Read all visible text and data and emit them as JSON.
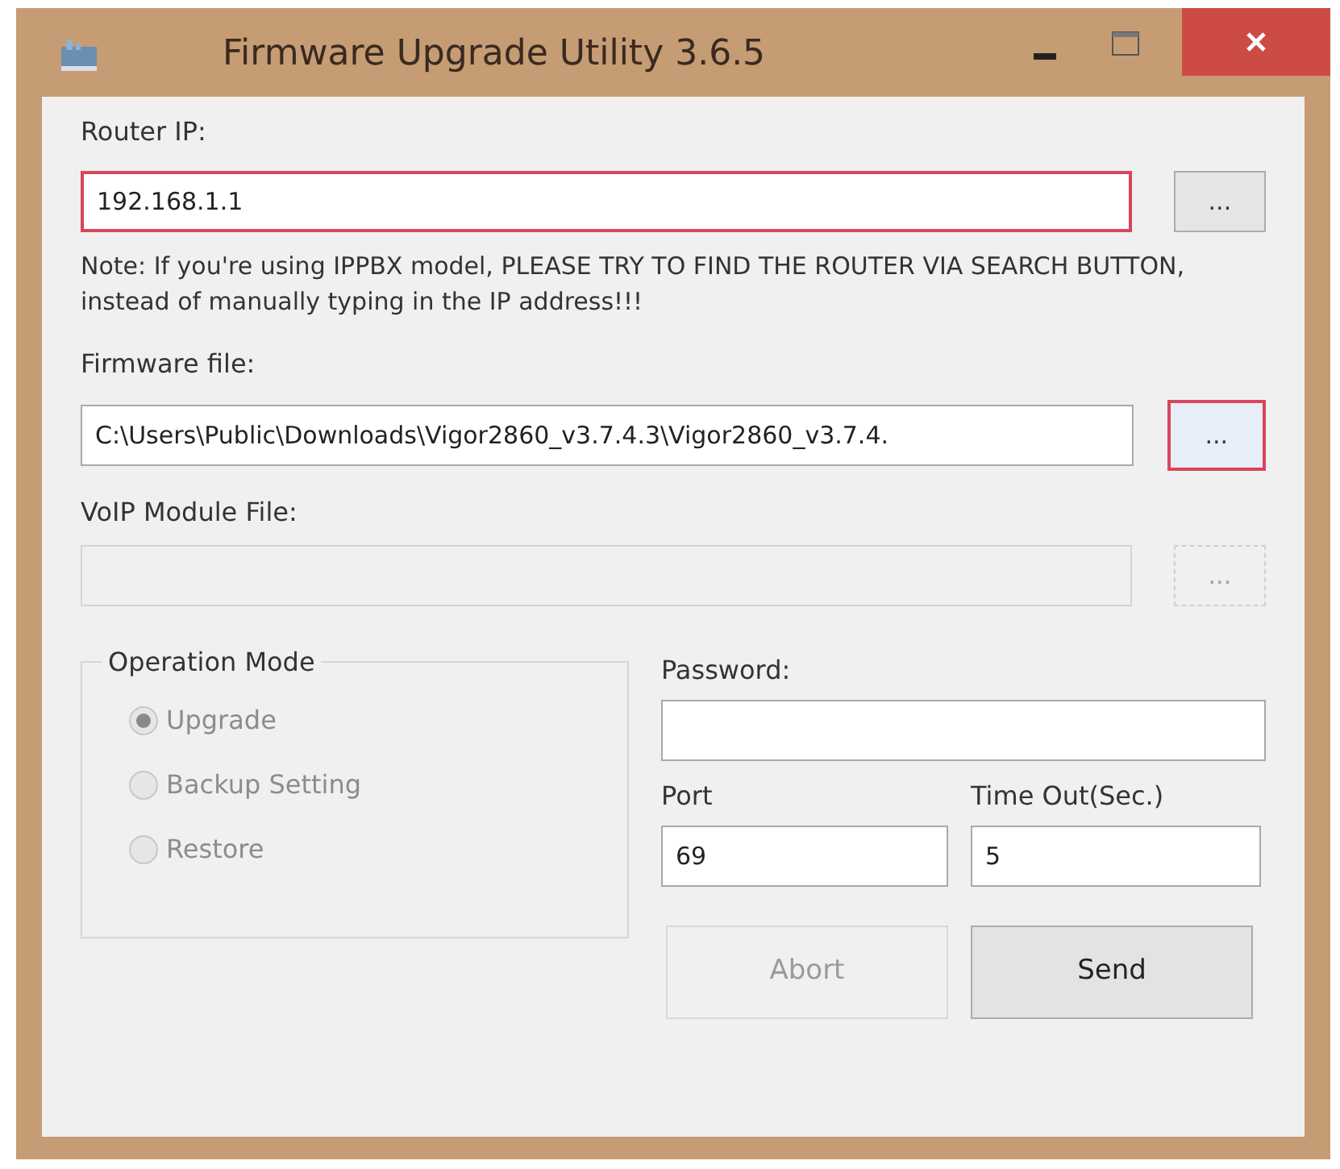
{
  "window": {
    "title": "Firmware Upgrade Utility 3.6.5"
  },
  "router_ip": {
    "label": "Router IP:",
    "value": "192.168.1.1",
    "highlighted": true,
    "browse": {
      "label": "...",
      "highlighted": false,
      "disabled": false
    }
  },
  "note": "Note: If you're using IPPBX model, PLEASE TRY TO FIND THE ROUTER VIA SEARCH BUTTON, instead of manually typing in the IP address!!!",
  "firmware_file": {
    "label": "Firmware file:",
    "value": "C:\\Users\\Public\\Downloads\\Vigor2860_v3.7.4.3\\Vigor2860_v3.7.4.",
    "highlighted": false,
    "browse": {
      "label": "...",
      "highlighted": true,
      "disabled": false
    }
  },
  "voip_file": {
    "label": "VoIP Module File:",
    "disabled": true,
    "browse": {
      "label": "...",
      "highlighted": false,
      "disabled": true
    }
  },
  "operation_mode": {
    "title": "Operation Mode",
    "options": [
      {
        "label": "Upgrade",
        "selected": true,
        "disabled": true
      },
      {
        "label": "Backup Setting",
        "selected": false,
        "disabled": true
      },
      {
        "label": "Restore",
        "selected": false,
        "disabled": true
      }
    ]
  },
  "password": {
    "label": "Password:"
  },
  "port": {
    "label": "Port",
    "value": "69"
  },
  "timeout": {
    "label": "Time Out(Sec.)",
    "value": "5"
  },
  "buttons": [
    {
      "label": "Abort",
      "disabled": true
    },
    {
      "label": "Send",
      "disabled": false
    }
  ]
}
